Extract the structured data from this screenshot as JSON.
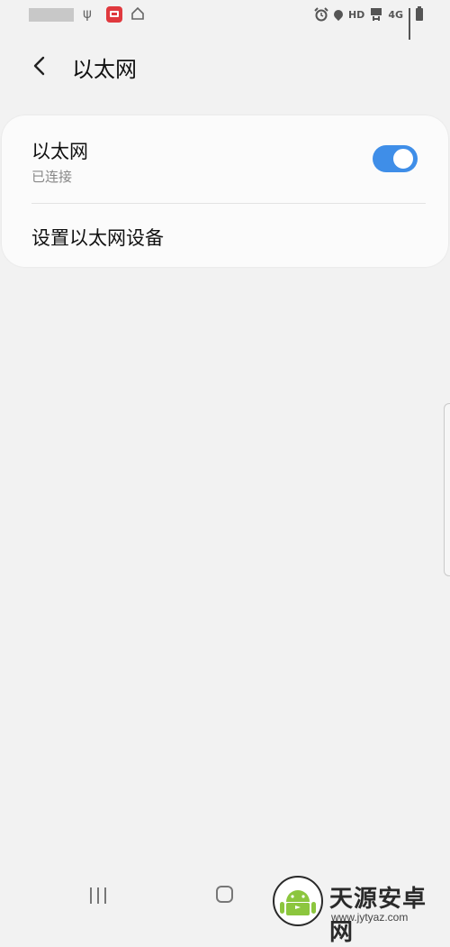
{
  "status_bar": {
    "hd_label": "HD",
    "network_label": "4G"
  },
  "header": {
    "title": "以太网"
  },
  "ethernet_row": {
    "title": "以太网",
    "status": "已连接",
    "toggle_on": true
  },
  "setup_row": {
    "title": "设置以太网设备"
  },
  "watermark": {
    "name": "天源安卓网",
    "url": "www.jytyaz.com"
  },
  "colors": {
    "accent": "#3f8ee8",
    "background": "#f2f2f2",
    "card": "#fbfbfb"
  }
}
